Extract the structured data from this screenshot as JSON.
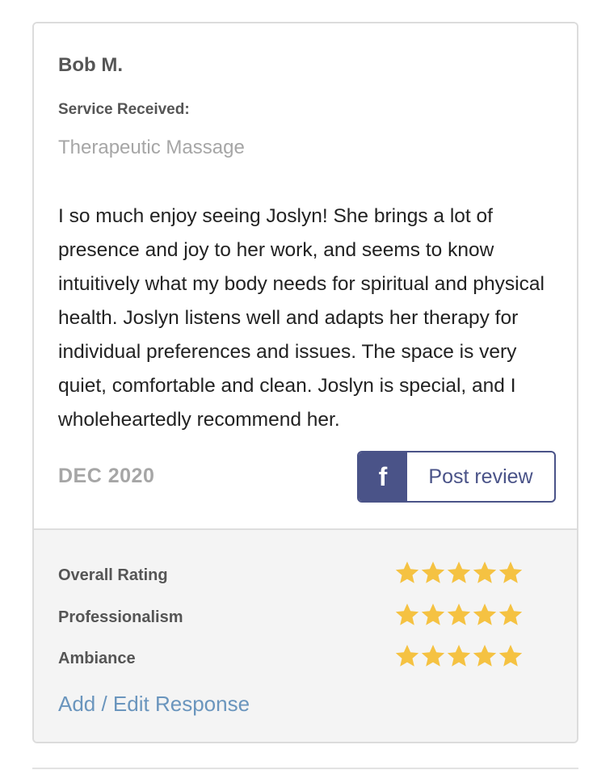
{
  "review": {
    "reviewer_name": "Bob M.",
    "service_label": "Service Received:",
    "service_value": "Therapeutic Massage",
    "text": "I so much enjoy seeing Joslyn! She brings a lot of presence and joy to her work, and seems to know intuitively what my body needs for spiritual and physical health. Joslyn listens well and adapts her therapy for individual preferences and issues. The space is very quiet, comfortable and clean. Joslyn is special, and I wholeheartedly recommend her.",
    "date": "DEC 2020"
  },
  "share": {
    "icon": "facebook-icon",
    "icon_glyph": "f",
    "label": "Post review",
    "color": "#4a5388"
  },
  "ratings": [
    {
      "label": "Overall Rating",
      "stars": 5,
      "max": 5
    },
    {
      "label": "Professionalism",
      "stars": 5,
      "max": 5
    },
    {
      "label": "Ambiance",
      "stars": 5,
      "max": 5
    }
  ],
  "star_color": "#f5c242",
  "response_link": "Add / Edit Response"
}
